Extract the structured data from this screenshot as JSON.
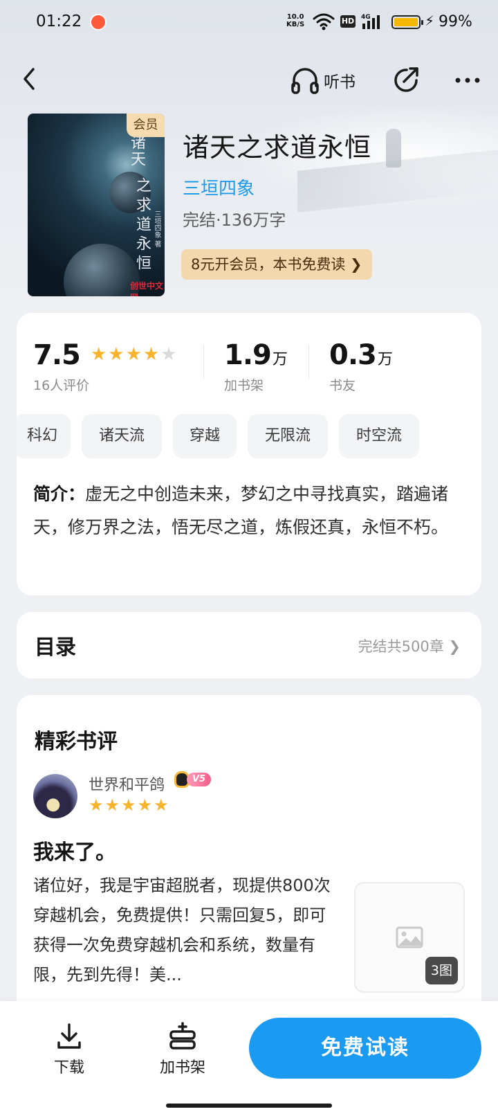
{
  "status_bar": {
    "time": "01:22",
    "net_speed_value": "10.0",
    "net_speed_unit": "KB/S",
    "hd": "HD",
    "signal": "4G",
    "battery_pct": "99%",
    "battery_level": 0.99
  },
  "nav": {
    "listen_label": "听书"
  },
  "book": {
    "title": "诸天之求道永恒",
    "author": "三垣四象",
    "meta": "完结·136万字",
    "vip_badge": "会员",
    "vip_promo": "8元开会员，本书免费读 ❯",
    "cover": {
      "title_line1": "诸天",
      "title_line2": "之求道永恒",
      "author": "三垣四象 著",
      "logo": "创世中文网"
    }
  },
  "stats": {
    "rating": "7.5",
    "rating_stars": 4,
    "rating_label": "16人评价",
    "bookshelf_num": "1.9",
    "bookshelf_unit": "万",
    "bookshelf_label": "加书架",
    "fans_num": "0.3",
    "fans_unit": "万",
    "fans_label": "书友"
  },
  "tags": [
    "科幻",
    "诸天流",
    "穿越",
    "无限流",
    "时空流"
  ],
  "intro": {
    "label": "简介：",
    "text": "虚无之中创造未来，梦幻之中寻找真实，踏遍诸天，修万界之法，悟无尽之道，炼假还真，永恒不朽。"
  },
  "toc": {
    "title": "目录",
    "status": "完结共500章 ❯"
  },
  "reviews": {
    "heading": "精彩书评",
    "items": [
      {
        "user": "世界和平鸽",
        "vip_level": "V5",
        "stars": 5,
        "title": "我来了。",
        "body": "诸位好，我是宇宙超脱者，现提供800次穿越机会，免费提供！只需回复5，即可获得一次免费穿越机会和系统，数量有限，先到先得！美...",
        "image_count": "3图"
      }
    ]
  },
  "bottom_bar": {
    "download_label": "下载",
    "add_shelf_label": "加书架",
    "read_label": "免费试读"
  },
  "colors": {
    "accent_blue": "#1a9af0",
    "author_blue": "#1e9be8",
    "star_gold": "#f7b32b",
    "vip_gold": "#f2d8ac"
  }
}
